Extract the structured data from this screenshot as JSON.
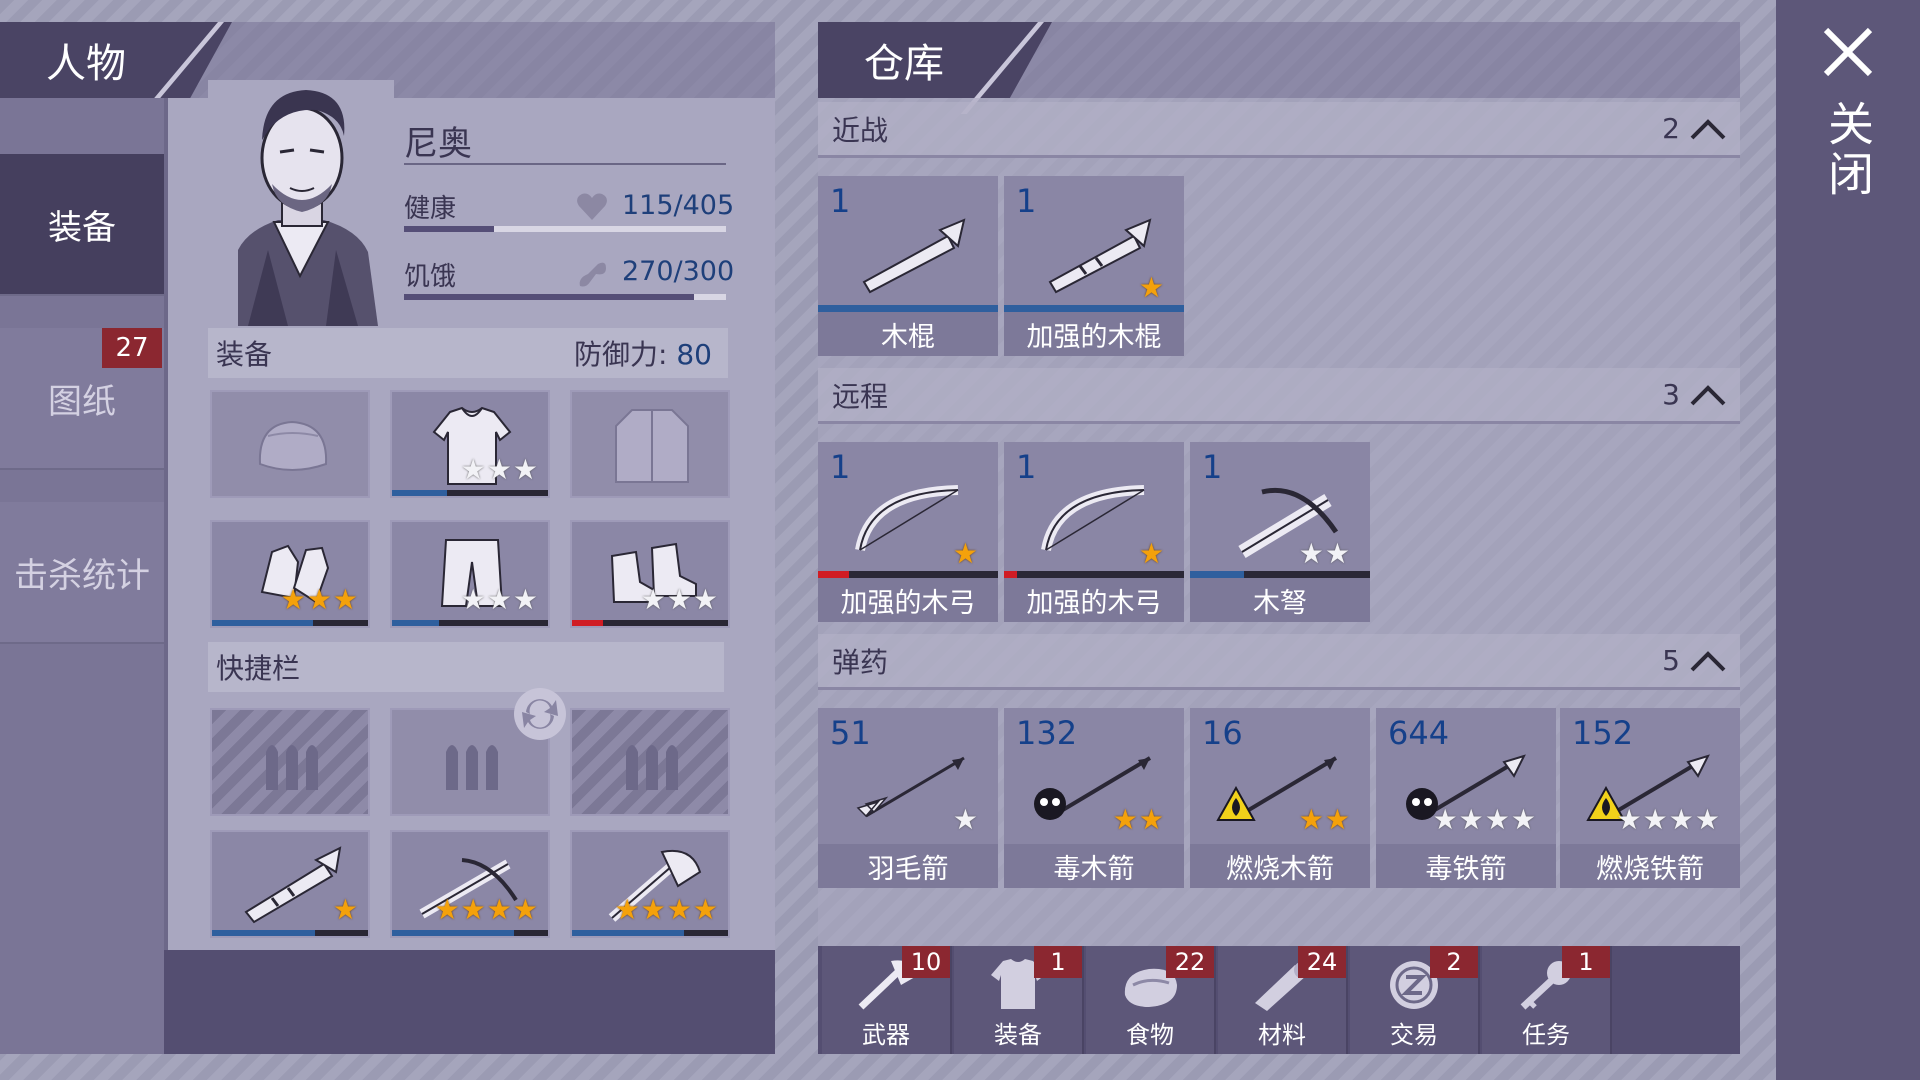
{
  "character": {
    "header": "人物",
    "name": "尼奥",
    "stats": {
      "health_label": "健康",
      "health_value": "115/405",
      "health_fraction": 0.28,
      "hunger_label": "饥饿",
      "hunger_value": "270/300",
      "hunger_fraction": 0.9
    },
    "side_tabs": [
      {
        "label": "装备",
        "active": true
      },
      {
        "label": "图纸",
        "badge": "27"
      },
      {
        "label": "击杀统计"
      }
    ],
    "equipment": {
      "title": "装备",
      "defense_label": "防御力:",
      "defense_value": "80",
      "slots": [
        {
          "item": "hat",
          "stars": 0,
          "durability": null
        },
        {
          "item": "shirt",
          "stars": 3,
          "star_color": "white",
          "durability": 0.35
        },
        {
          "item": "jacket",
          "stars": 0,
          "durability": null
        },
        {
          "item": "gloves",
          "stars": 3,
          "star_color": "gold",
          "durability": 0.65
        },
        {
          "item": "pants",
          "stars": 3,
          "star_color": "white",
          "durability": 0.3
        },
        {
          "item": "boots",
          "stars": 3,
          "star_color": "white",
          "durability": 0.2,
          "durability_color": "#d01c24"
        }
      ]
    },
    "hotbar": {
      "title": "快捷栏",
      "ammo_slots": [
        {
          "state": "locked"
        },
        {
          "state": "empty"
        },
        {
          "state": "locked"
        }
      ],
      "weapon_slots": [
        {
          "item": "reinforced-stick",
          "stars": 1,
          "star_color": "gold",
          "durability": 0.66
        },
        {
          "item": "crossbow",
          "stars": 4,
          "star_color": "gold",
          "durability": 0.78
        },
        {
          "item": "axe",
          "stars": 4,
          "star_color": "gold",
          "durability": 0.72
        }
      ]
    }
  },
  "warehouse": {
    "header": "仓库",
    "categories": [
      {
        "name": "近战",
        "count": "2",
        "items": [
          {
            "qty": "1",
            "name": "木棍",
            "icon": "stick-icon",
            "stars": 0,
            "durability": 1.0,
            "durability_color": "#2f5f9e"
          },
          {
            "qty": "1",
            "name": "加强的木棍",
            "icon": "reinforced-stick-icon",
            "stars": 1,
            "star_color": "gold",
            "durability": 1.0,
            "durability_color": "#2f5f9e"
          }
        ]
      },
      {
        "name": "远程",
        "count": "3",
        "items": [
          {
            "qty": "1",
            "name": "加强的木弓",
            "icon": "bow-icon",
            "stars": 1,
            "star_color": "gold",
            "durability": 0.17,
            "durability_color": "#d01c24"
          },
          {
            "qty": "1",
            "name": "加强的木弓",
            "icon": "bow-icon",
            "stars": 1,
            "star_color": "gold",
            "durability": 0.07,
            "durability_color": "#d01c24"
          },
          {
            "qty": "1",
            "name": "木弩",
            "icon": "crossbow-icon",
            "stars": 2,
            "star_color": "white",
            "durability": 0.3,
            "durability_color": "#2f5f9e"
          }
        ]
      },
      {
        "name": "弹药",
        "count": "5",
        "items": [
          {
            "qty": "51",
            "name": "羽毛箭",
            "icon": "feather-arrow-icon",
            "stars": 1,
            "star_color": "white"
          },
          {
            "qty": "132",
            "name": "毒木箭",
            "icon": "poison-wood-arrow-icon",
            "stars": 2,
            "star_color": "gold",
            "hazard": "poison"
          },
          {
            "qty": "16",
            "name": "燃烧木箭",
            "icon": "fire-wood-arrow-icon",
            "stars": 2,
            "star_color": "gold",
            "hazard": "fire"
          },
          {
            "qty": "644",
            "name": "毒铁箭",
            "icon": "poison-iron-arrow-icon",
            "stars": 4,
            "star_color": "white",
            "hazard": "poison"
          },
          {
            "qty": "152",
            "name": "燃烧铁箭",
            "icon": "fire-iron-arrow-icon",
            "stars": 4,
            "star_color": "white",
            "hazard": "fire"
          }
        ]
      }
    ],
    "filter_tabs": [
      {
        "label": "武器",
        "badge": "10",
        "icon": "axe-icon"
      },
      {
        "label": "装备",
        "badge": "1",
        "icon": "shirt-icon"
      },
      {
        "label": "食物",
        "badge": "22",
        "icon": "food-icon"
      },
      {
        "label": "材料",
        "badge": "24",
        "icon": "log-icon"
      },
      {
        "label": "交易",
        "badge": "2",
        "icon": "coin-icon"
      },
      {
        "label": "任务",
        "badge": "1",
        "icon": "key-icon"
      }
    ]
  },
  "close": {
    "label": "关闭"
  },
  "colors": {
    "accent": "#4a4464",
    "badge": "#8b2730",
    "qty": "#15408a",
    "durability_blue": "#2f5f9e",
    "durability_red": "#d01c24",
    "star_gold": "#f4a10b"
  }
}
